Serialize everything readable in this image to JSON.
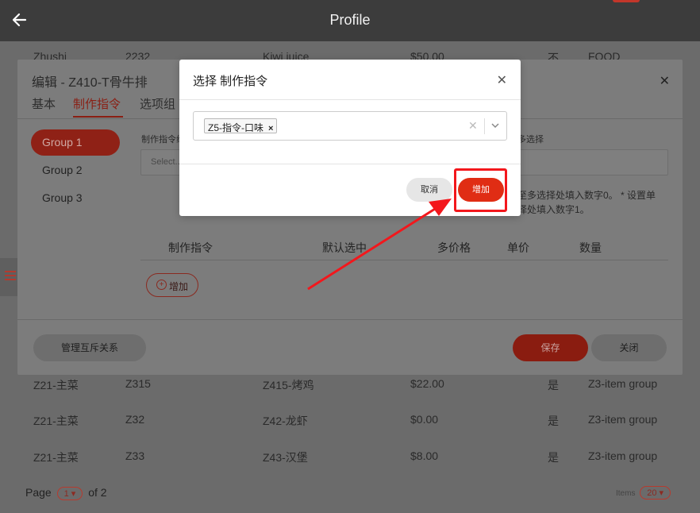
{
  "header": {
    "title": "Profile",
    "back_icon": "arrow-left-icon"
  },
  "bg_table": {
    "top_row": [
      "Zhushi",
      "2232",
      "Kiwi juice",
      "$50.00",
      "不",
      "FOOD"
    ],
    "rows": [
      [
        "Z21-主菜",
        "Z315",
        "Z415-烤鸡",
        "$22.00",
        "是",
        "Z3-item group"
      ],
      [
        "Z21-主菜",
        "Z32",
        "Z42-龙虾",
        "$0.00",
        "是",
        "Z3-item group"
      ],
      [
        "Z21-主菜",
        "Z33",
        "Z43-汉堡",
        "$8.00",
        "是",
        "Z3-item group"
      ]
    ]
  },
  "pagination": {
    "page_label": "Page",
    "page": "1",
    "of_label": "of 2",
    "items_label": "Items",
    "items_per_page": "20"
  },
  "edit_modal": {
    "title": "编辑 - Z410-T骨牛排",
    "tabs": [
      "基本",
      "制作指令",
      "选项组"
    ],
    "groups": [
      "Group 1",
      "Group 2",
      "Group 3"
    ],
    "field_label": "制作指令组",
    "field_placeholder": "Select...",
    "right_label": "多选择",
    "hint_line1": "至多选择处填入数字0。 * 设置单",
    "hint_line2": "择处填入数字1。",
    "columns": [
      "制作指令",
      "默认选中",
      "多价格",
      "单价",
      "数量"
    ],
    "add_label": "增加",
    "manage_button": "管理互斥关系",
    "save_button": "保存",
    "close_button": "关闭"
  },
  "select_modal": {
    "title": "选择 制作指令",
    "selected_tag": "Z5-指令-口味",
    "cancel_label": "取消",
    "add_label": "增加"
  },
  "colors": {
    "accent": "#e02d14",
    "highlight": "#f3171c",
    "topbar": "#3c3c3c"
  }
}
